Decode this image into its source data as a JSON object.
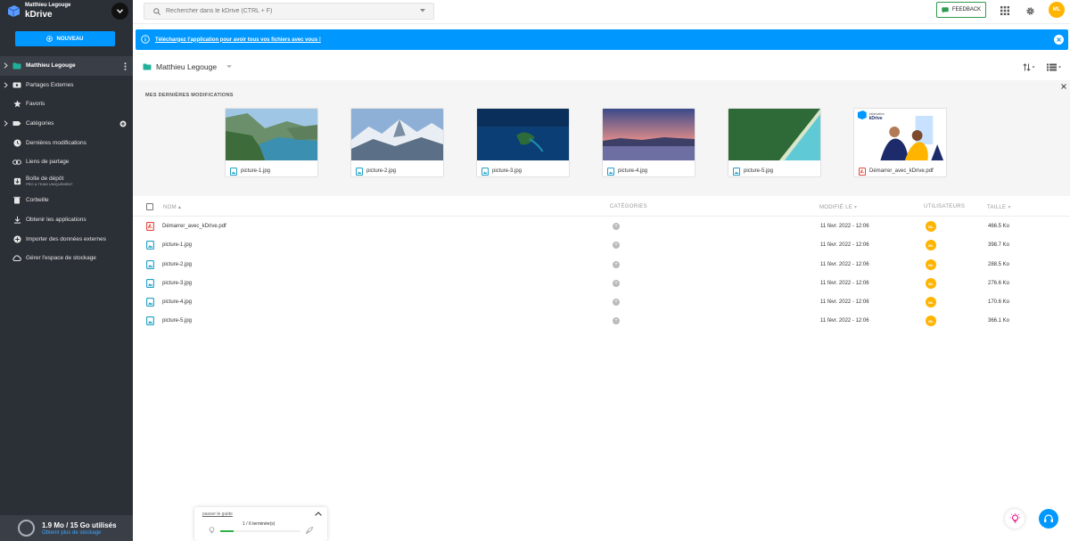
{
  "sidebar": {
    "user_name": "Matthieu Legouge",
    "app_name": "kDrive",
    "new_button": "NOUVEAU",
    "items": [
      {
        "label": "Matthieu Legouge",
        "icon": "drive-icon",
        "active": true
      },
      {
        "label": "Partages Externes",
        "icon": "external-shares-icon"
      },
      {
        "label": "Favoris",
        "icon": "star-icon"
      },
      {
        "label": "Catégories",
        "icon": "tag-icon"
      },
      {
        "label": "Dernières modifications",
        "icon": "clock-icon"
      },
      {
        "label": "Liens de partage",
        "icon": "link-icon"
      },
      {
        "label": "Boîte de dépôt",
        "sub": "PRO & TEAM UNIQUEMENT",
        "icon": "dropbox-icon"
      },
      {
        "label": "Corbeille",
        "icon": "trash-icon"
      },
      {
        "label": "Obtenir les applications",
        "icon": "download-icon"
      },
      {
        "label": "Importer des données externes",
        "icon": "import-icon"
      },
      {
        "label": "Gérer l'espace de stockage",
        "icon": "storage-icon"
      }
    ],
    "storage": {
      "usage": "1.9 Mo / 15 Go utilisés",
      "more": "Obtenir plus de stockage"
    }
  },
  "header": {
    "search_placeholder": "Rechercher dans le kDrive (CTRL + F)",
    "feedback": "FEEDBACK",
    "avatar": "ML"
  },
  "banner": {
    "text": "Téléchargez l'application pour avoir tous vos fichiers avec vous !"
  },
  "breadcrumb": {
    "title": "Matthieu Legouge"
  },
  "recent": {
    "title": "MES DERNIÈRES MODIFICATIONS",
    "cards": [
      {
        "name": "picture-1.jpg",
        "type": "image"
      },
      {
        "name": "picture-2.jpg",
        "type": "image"
      },
      {
        "name": "picture-3.jpg",
        "type": "image"
      },
      {
        "name": "picture-4.jpg",
        "type": "image"
      },
      {
        "name": "picture-5.jpg",
        "type": "image"
      },
      {
        "name": "Démarrer_avec_kDrive.pdf",
        "type": "pdf",
        "thumb_text": [
          "Information",
          "kDrive"
        ]
      }
    ]
  },
  "table": {
    "columns": {
      "name": "NOM",
      "categories": "CATÉGORIES",
      "modified": "MODIFIÉ LE",
      "users": "UTILISATEURS",
      "size": "TAILLE"
    },
    "rows": [
      {
        "name": "Démarrer_avec_kDrive.pdf",
        "type": "pdf",
        "modified": "11 févr. 2022 - 12:06",
        "user": "ML",
        "size": "466.5 Ko"
      },
      {
        "name": "picture-1.jpg",
        "type": "image",
        "modified": "11 févr. 2022 - 12:06",
        "user": "ML",
        "size": "398.7 Ko"
      },
      {
        "name": "picture-2.jpg",
        "type": "image",
        "modified": "11 févr. 2022 - 12:06",
        "user": "ML",
        "size": "288.5 Ko"
      },
      {
        "name": "picture-3.jpg",
        "type": "image",
        "modified": "11 févr. 2022 - 12:06",
        "user": "ML",
        "size": "276.6 Ko"
      },
      {
        "name": "picture-4.jpg",
        "type": "image",
        "modified": "11 févr. 2022 - 12:06",
        "user": "ML",
        "size": "170.6 Ko"
      },
      {
        "name": "picture-5.jpg",
        "type": "image",
        "modified": "11 févr. 2022 - 12:06",
        "user": "ML",
        "size": "366.1 Ko"
      }
    ]
  },
  "guide": {
    "skip": "passer le guide",
    "progress": "1 / 6 terminée(s)",
    "completed_fraction": 0.17
  },
  "colors": {
    "accent": "#0098ff",
    "sidebar": "#2b2f36",
    "avatar": "#ffb400",
    "success": "#2eb04a"
  }
}
